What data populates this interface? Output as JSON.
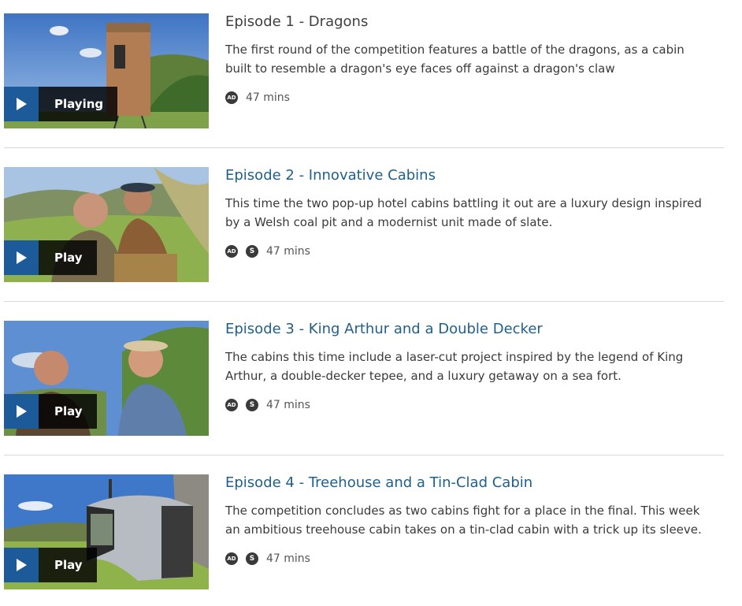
{
  "episodes": [
    {
      "title": "Episode 1 - Dragons",
      "description_line1": "The first round of the competition features a battle of the dragons, as a cabin",
      "description_line2": "built to resemble a dragon's eye faces off against a dragon's claw",
      "play_label": "Playing",
      "badges": [
        "AD"
      ],
      "duration": "47 mins"
    },
    {
      "title": "Episode 2 - Innovative Cabins",
      "description_line1": "This time the two pop-up hotel cabins battling it out are a luxury design inspired",
      "description_line2": "by a Welsh coal pit and a modernist unit made of slate.",
      "play_label": "Play",
      "badges": [
        "AD",
        "S"
      ],
      "duration": "47 mins"
    },
    {
      "title": "Episode 3 - King Arthur and a Double Decker",
      "description_line1": "The cabins this time include a laser-cut project inspired by the legend of King",
      "description_line2": "Arthur, a double-decker tepee, and a luxury getaway on a sea fort.",
      "play_label": "Play",
      "badges": [
        "AD",
        "S"
      ],
      "duration": "47 mins"
    },
    {
      "title": "Episode 4 - Treehouse and a Tin-Clad Cabin",
      "description_line1": "The competition concludes as two cabins fight for a place in the final. This week",
      "description_line2": "an ambitious treehouse cabin takes on a tin-clad cabin with a trick up its sleeve.",
      "play_label": "Play",
      "badges": [
        "AD",
        "S"
      ],
      "duration": "47 mins"
    }
  ],
  "colors": {
    "link": "#1f5f8b",
    "play_accent": "#1d5a9a",
    "divider": "#d9d9d9"
  },
  "icons": {
    "play": "play-triangle-icon",
    "audio_description": "audio-description-icon",
    "signed": "sign-language-icon"
  }
}
